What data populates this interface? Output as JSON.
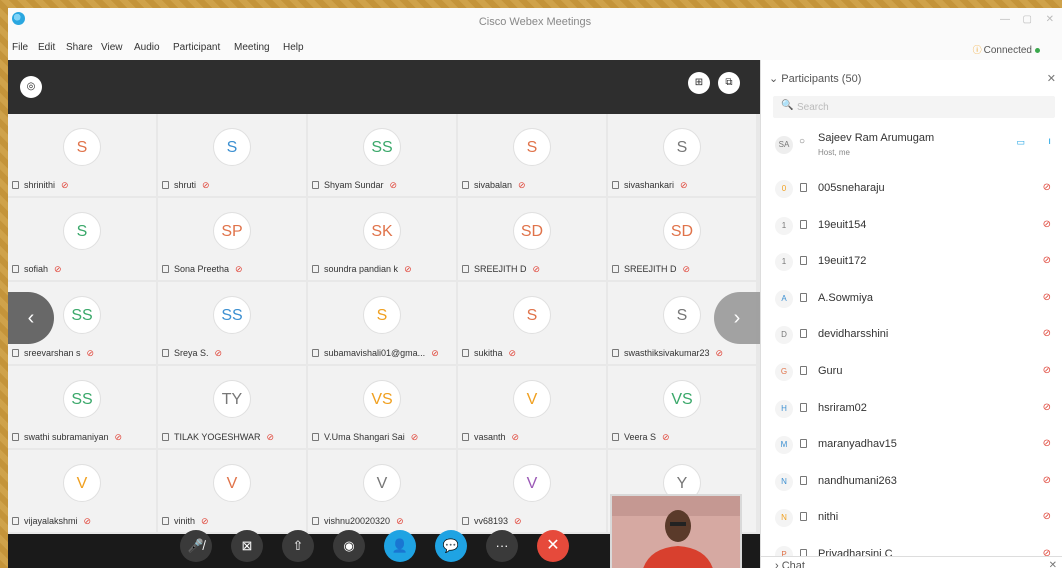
{
  "window": {
    "title": "Cisco Webex Meetings"
  },
  "menu": [
    "File",
    "Edit",
    "Share",
    "View",
    "Audio",
    "Participant",
    "Meeting",
    "Help"
  ],
  "status": {
    "connected_label": "Connected"
  },
  "video_grid": {
    "tiles": [
      {
        "initials": "S",
        "name": "shrinithi",
        "color": "#e0734a"
      },
      {
        "initials": "S",
        "name": "shruti",
        "color": "#3b8fd1"
      },
      {
        "initials": "SS",
        "name": "Shyam Sundar",
        "color": "#3aa86a"
      },
      {
        "initials": "S",
        "name": "sivabalan",
        "color": "#e0734a"
      },
      {
        "initials": "S",
        "name": "sivashankari",
        "color": "#777777"
      },
      {
        "initials": "S",
        "name": "sofiah",
        "color": "#3aa86a"
      },
      {
        "initials": "SP",
        "name": "Sona Preetha",
        "color": "#e0734a"
      },
      {
        "initials": "SK",
        "name": "soundra pandian k",
        "color": "#e0734a"
      },
      {
        "initials": "SD",
        "name": "SREEJITH D",
        "color": "#e0734a"
      },
      {
        "initials": "SD",
        "name": "SREEJITH D",
        "color": "#e0734a"
      },
      {
        "initials": "SS",
        "name": "sreevarshan s",
        "color": "#3aa86a"
      },
      {
        "initials": "SS",
        "name": "Sreya S.",
        "color": "#3b8fd1"
      },
      {
        "initials": "S",
        "name": "subamavishali01@gma...",
        "color": "#f0a020"
      },
      {
        "initials": "S",
        "name": "sukitha",
        "color": "#e0734a"
      },
      {
        "initials": "S",
        "name": "swasthiksivakumar23",
        "color": "#777777"
      },
      {
        "initials": "SS",
        "name": "swathi subramaniyan",
        "color": "#3aa86a"
      },
      {
        "initials": "TY",
        "name": "TILAK YOGESHWAR",
        "color": "#777777"
      },
      {
        "initials": "VS",
        "name": "V.Uma Shangari Sai",
        "color": "#f0a020"
      },
      {
        "initials": "V",
        "name": "vasanth",
        "color": "#f0a020"
      },
      {
        "initials": "VS",
        "name": "Veera S",
        "color": "#3aa86a"
      },
      {
        "initials": "V",
        "name": "vijayalakshmi",
        "color": "#f0a020"
      },
      {
        "initials": "V",
        "name": "vinith",
        "color": "#e0734a"
      },
      {
        "initials": "V",
        "name": "vishnu20020320",
        "color": "#777777"
      },
      {
        "initials": "V",
        "name": "vv68193",
        "color": "#9b59b6"
      },
      {
        "initials": "Y",
        "name": "",
        "color": "#777777"
      }
    ]
  },
  "toolbar": {
    "buttons": [
      {
        "name": "mute-button",
        "glyph": "🎤̸"
      },
      {
        "name": "stop-video-button",
        "glyph": "⊠"
      },
      {
        "name": "share-button",
        "glyph": "⇧"
      },
      {
        "name": "record-button",
        "glyph": "◉"
      },
      {
        "name": "participants-button",
        "glyph": "👤"
      },
      {
        "name": "chat-button",
        "glyph": "💬"
      },
      {
        "name": "more-button",
        "glyph": "···"
      },
      {
        "name": "leave-button",
        "glyph": "✕"
      }
    ]
  },
  "participants": {
    "header": "Participants (50)",
    "search_placeholder": "Search",
    "host": {
      "initials": "SA",
      "name": "Sajeev Ram Arumugam",
      "role": "Host, me"
    },
    "list": [
      {
        "initial": "0",
        "name": "005sneharaju",
        "color": "#f0a020"
      },
      {
        "initial": "1",
        "name": "19euit154",
        "color": "#777777"
      },
      {
        "initial": "1",
        "name": "19euit172",
        "color": "#777777"
      },
      {
        "initial": "A",
        "name": "A.Sowmiya",
        "color": "#3b8fd1"
      },
      {
        "initial": "D",
        "name": "devidharsshini",
        "color": "#777777"
      },
      {
        "initial": "G",
        "name": "Guru",
        "color": "#e0734a"
      },
      {
        "initial": "H",
        "name": "hsriram02",
        "color": "#3b8fd1"
      },
      {
        "initial": "M",
        "name": "maranyadhav15",
        "color": "#3b8fd1"
      },
      {
        "initial": "N",
        "name": "nandhumani263",
        "color": "#3b8fd1"
      },
      {
        "initial": "N",
        "name": "nithi",
        "color": "#f0a020"
      },
      {
        "initial": "P",
        "name": "Priyadharsini C",
        "color": "#e0734a"
      }
    ]
  },
  "chat": {
    "label": "Chat"
  }
}
